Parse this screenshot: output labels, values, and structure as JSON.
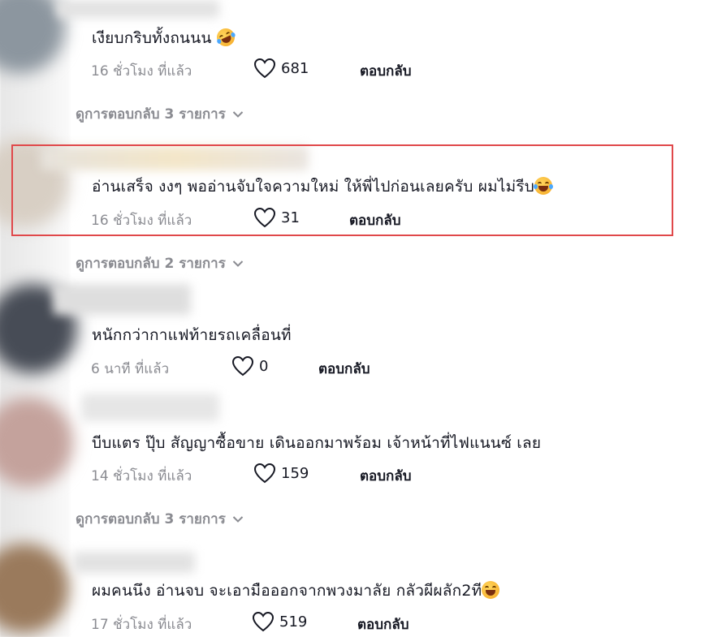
{
  "comments": [
    {
      "text": "เงียบกริบทั้งถนนน",
      "time": "16 ชั่วโมง ที่แล้ว",
      "likes": "681",
      "reply": "ตอบกลับ",
      "emoji": "rofl-emoji",
      "view_replies": "ดูการตอบกลับ 3 รายการ"
    },
    {
      "text": "อ่านเสร็จ งงๆ พออ่านจับใจความใหม่ ให้พี่ไปก่อนเลยครับ ผมไม่รีบ",
      "time": "16 ชั่วโมง ที่แล้ว",
      "likes": "31",
      "reply": "ตอบกลับ",
      "emoji": "joy-emoji",
      "view_replies": "ดูการตอบกลับ 2 รายการ",
      "highlighted": true
    },
    {
      "text": "หนักกว่ากาแฟท้ายรถเคลื่อนที่",
      "time": "6 นาที ที่แล้ว",
      "likes": "0",
      "reply": "ตอบกลับ"
    },
    {
      "text": "บีบแตร ปุ๊บ สัญญาซื้อขาย เดินออกมาพร้อม เจ้าหน้าที่ไฟแนนซ์ เลย",
      "time": "14 ชั่วโมง ที่แล้ว",
      "likes": "159",
      "reply": "ตอบกลับ",
      "view_replies": "ดูการตอบกลับ 3 รายการ"
    },
    {
      "text": "ผมคนนึง อ่านจบ จะเอามือออกจากพวงมาลัย กลัวผีผลัก2ที",
      "time": "17 ชั่วโมง ที่แล้ว",
      "likes": "519",
      "reply": "ตอบกลับ",
      "emoji": "grin-emoji"
    }
  ],
  "colors": {
    "highlight_border": "#e0484a",
    "text_primary": "#161823",
    "text_secondary": "#8a8b91"
  },
  "icons": {
    "like": "heart-outline-icon",
    "expand": "chevron-down-icon"
  }
}
